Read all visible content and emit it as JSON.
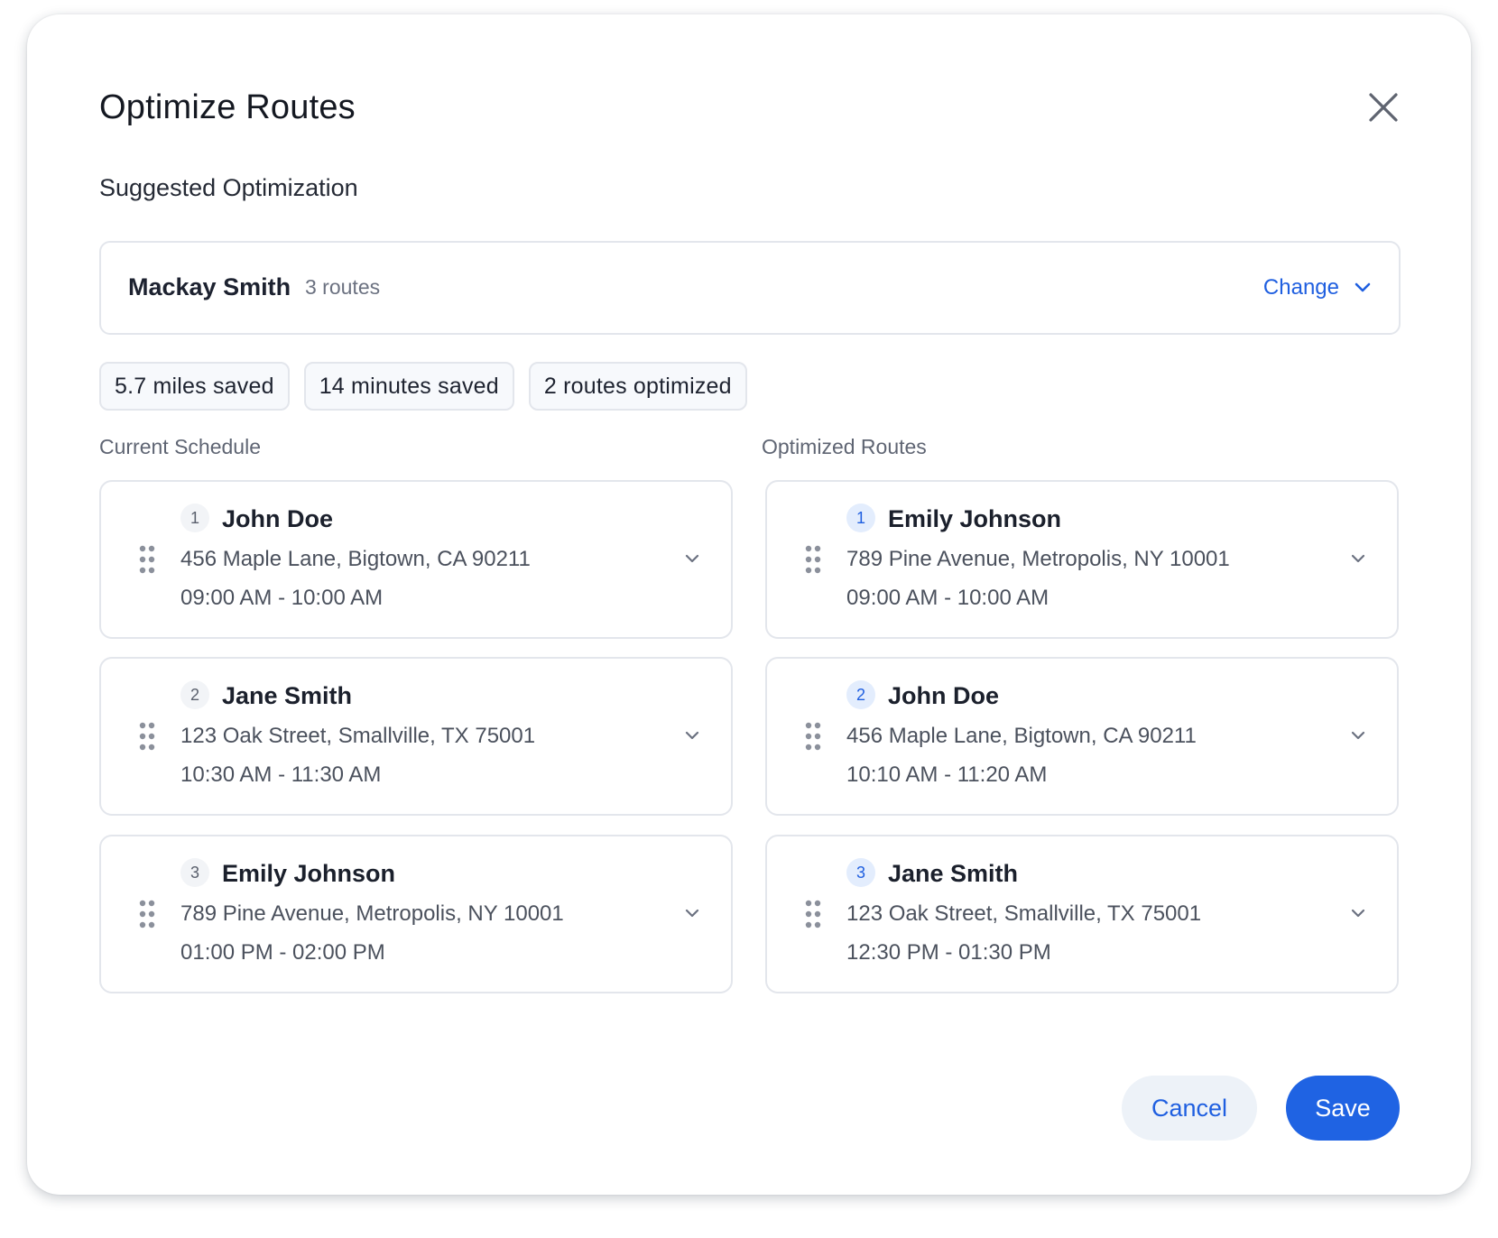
{
  "dialog": {
    "title": "Optimize Routes",
    "subtitle": "Suggested Optimization"
  },
  "driver": {
    "name": "Mackay Smith",
    "routes": "3 routes",
    "change_label": "Change"
  },
  "stats": [
    "5.7 miles saved",
    "14 minutes saved",
    "2 routes optimized"
  ],
  "current": {
    "label": "Current Schedule",
    "items": [
      {
        "num": "1",
        "name": "John Doe",
        "address": "456 Maple Lane, Bigtown, CA 90211",
        "time": "09:00 AM - 10:00 AM"
      },
      {
        "num": "2",
        "name": "Jane Smith",
        "address": "123 Oak Street, Smallville, TX 75001",
        "time": "10:30 AM - 11:30 AM"
      },
      {
        "num": "3",
        "name": "Emily Johnson",
        "address": "789 Pine Avenue, Metropolis, NY 10001",
        "time": "01:00 PM - 02:00 PM"
      }
    ]
  },
  "optimized": {
    "label": "Optimized Routes",
    "items": [
      {
        "num": "1",
        "name": "Emily Johnson",
        "address": "789 Pine Avenue, Metropolis, NY 10001",
        "time": "09:00 AM - 10:00 AM"
      },
      {
        "num": "2",
        "name": "John Doe",
        "address": "456 Maple Lane, Bigtown, CA 90211",
        "time": "10:10 AM - 11:20 AM"
      },
      {
        "num": "3",
        "name": "Jane Smith",
        "address": "123 Oak Street, Smallville, TX 75001",
        "time": "12:30 PM - 01:30 PM"
      }
    ]
  },
  "footer": {
    "cancel_label": "Cancel",
    "save_label": "Save"
  },
  "colors": {
    "accent": "#1f63e3",
    "border": "#e3e6ec",
    "badge_blue_bg": "#e3edfd"
  },
  "icons": {
    "close": "close-icon",
    "dropdown": "chevron-down-icon",
    "drag": "drag-handle-icon"
  }
}
